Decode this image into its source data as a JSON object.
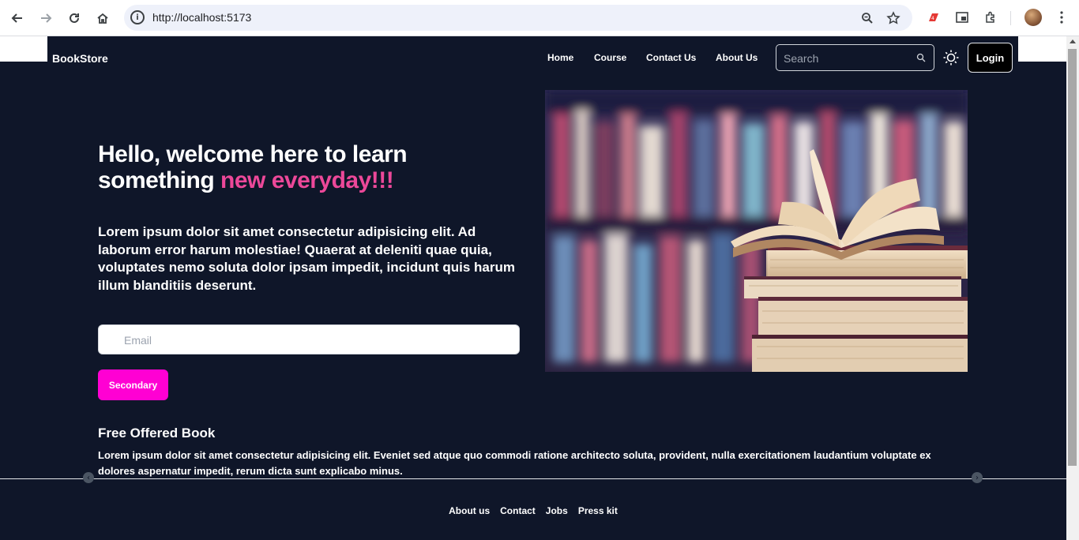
{
  "browser": {
    "url": "http://localhost:5173",
    "icons": [
      "back-icon",
      "forward-icon",
      "reload-icon",
      "home-icon",
      "info-icon",
      "zoom-icon",
      "star-icon",
      "extension-red-icon",
      "picture-in-picture-icon",
      "puzzle-icon",
      "profile-avatar",
      "more-menu-icon"
    ]
  },
  "navbar": {
    "brand": "BookStore",
    "menu": [
      "Home",
      "Course",
      "Contact Us",
      "About Us"
    ],
    "search_placeholder": "Search",
    "login_label": "Login"
  },
  "hero": {
    "title_part1": "Hello, welcome here to learn something ",
    "title_accent": "new everyday!!!",
    "text": "Lorem ipsum dolor sit amet consectetur adipisicing elit. Ad laborum error harum molestiae! Quaerat at deleniti quae quia, voluptates nemo soluta dolor ipsam impedit, incidunt quis harum illum blanditiis deserunt.",
    "email_placeholder": "Email",
    "button_label": "Secondary"
  },
  "free_section": {
    "title": "Free Offered Book",
    "text": "Lorem ipsum dolor sit amet consectetur adipisicing elit. Eveniet sed atque quo commodi ratione architecto soluta, provident, nulla exercitationem laudantium voluptate ex dolores aspernatur impedit, rerum dicta sunt explicabo minus."
  },
  "footer": {
    "links": [
      "About us",
      "Contact",
      "Jobs",
      "Press kit"
    ]
  },
  "colors": {
    "background": "#0f1629",
    "accent": "#ec4899",
    "button": "#ff00d3"
  }
}
